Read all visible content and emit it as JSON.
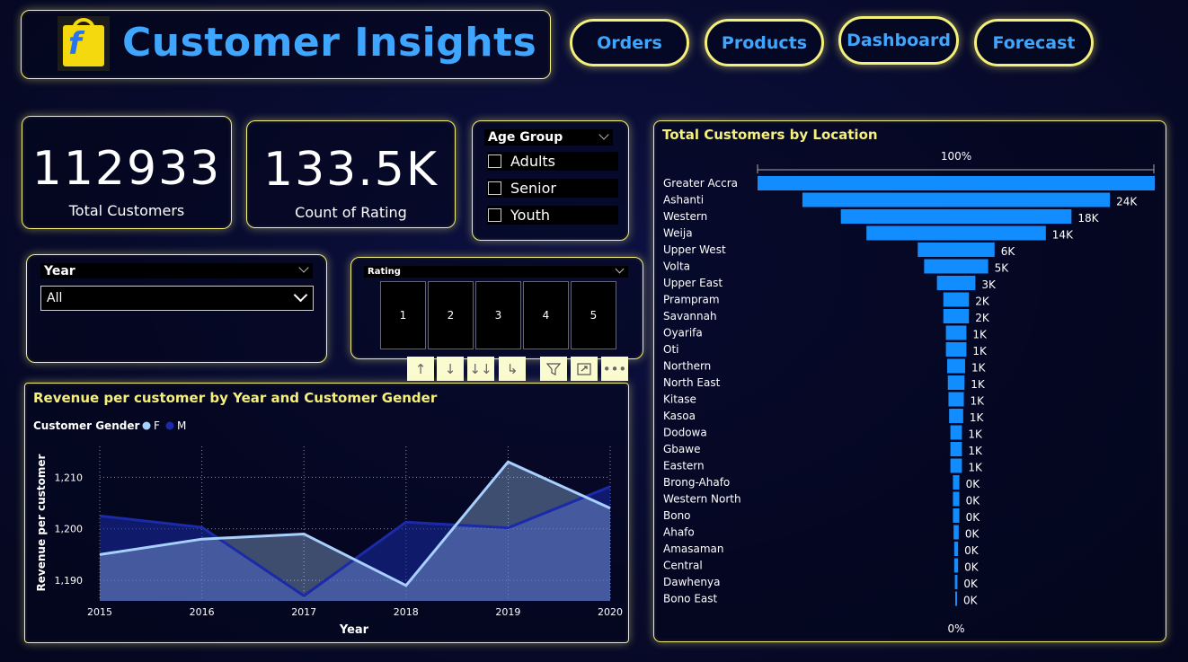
{
  "header": {
    "title": "Customer Insights"
  },
  "nav": {
    "orders": "Orders",
    "products": "Products",
    "dashboard": "Dashboard",
    "forecast": "Forecast"
  },
  "kpis": {
    "total_customers": {
      "value": "112933",
      "label": "Total Customers"
    },
    "count_rating": {
      "value": "133.5K",
      "label": "Count of Rating"
    }
  },
  "age_group": {
    "label": "Age Group",
    "options": [
      "Adults",
      "Senior",
      "Youth"
    ]
  },
  "year_slicer": {
    "label": "Year",
    "selected": "All"
  },
  "rating_slicer": {
    "label": "Rating",
    "options": [
      "1",
      "2",
      "3",
      "4",
      "5"
    ]
  },
  "colors": {
    "accent": "#f5f07a",
    "title_blue": "#3fa6ff",
    "bar": "#118dff",
    "female": "#a8d0ff",
    "male": "#1a2aa8"
  },
  "revenue_chart": {
    "chart_data": {
      "type": "area",
      "title": "Revenue per customer by Year and Customer Gender",
      "legend_title": "Customer Gender",
      "xlabel": "Year",
      "ylabel": "Revenue per customer",
      "x": [
        "2015",
        "2016",
        "2017",
        "2018",
        "2019",
        "2020"
      ],
      "yticks": [
        "1,190",
        "1,200",
        "1,210"
      ],
      "ylim": [
        1186,
        1216
      ],
      "legend_position": "top-left",
      "series": [
        {
          "name": "F",
          "values": [
            1195,
            1198,
            1199,
            1189,
            1213,
            1204
          ]
        },
        {
          "name": "M",
          "values": [
            1202.5,
            1200.3,
            1187,
            1201.3,
            1200.2,
            1208.2
          ]
        }
      ]
    }
  },
  "location_chart": {
    "chart_data": {
      "type": "bar",
      "subtype": "funnel",
      "title": "Total Customers by Location",
      "top_label": "100%",
      "bottom_label": "0%",
      "categories": [
        "Greater Accra",
        "Ashanti",
        "Western",
        "Weija",
        "Upper West",
        "Volta",
        "Upper East",
        "Prampram",
        "Savannah",
        "Oyarifa",
        "Oti",
        "Northern",
        "North East",
        "Kitase",
        "Kasoa",
        "Dodowa",
        "Gbawe",
        "Eastern",
        "Brong-Ahafo",
        "Western North",
        "Bono",
        "Ahafo",
        "Amasaman",
        "Central",
        "Dawhenya",
        "Bono East"
      ],
      "values": [
        31000,
        24000,
        18000,
        14000,
        6000,
        5000,
        3000,
        2000,
        2000,
        1600,
        1600,
        1400,
        1300,
        1200,
        1100,
        900,
        900,
        900,
        500,
        500,
        500,
        400,
        300,
        300,
        200,
        100
      ],
      "labels": [
        "",
        "24K",
        "18K",
        "14K",
        "6K",
        "5K",
        "3K",
        "2K",
        "2K",
        "1K",
        "1K",
        "1K",
        "1K",
        "1K",
        "1K",
        "1K",
        "1K",
        "1K",
        "0K",
        "0K",
        "0K",
        "0K",
        "0K",
        "0K",
        "0K",
        "0K"
      ]
    }
  }
}
